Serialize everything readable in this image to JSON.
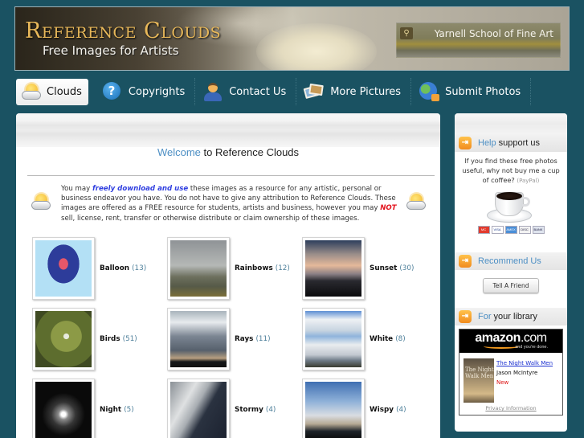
{
  "header": {
    "site_title": "Reference Clouds",
    "tagline": "Free Images for Artists",
    "sponsor": "Yarnell School of Fine Art",
    "sponsor_icon": "magnifier-icon"
  },
  "nav": {
    "items": [
      {
        "label": "Clouds",
        "icon": "sun-cloud-icon",
        "active": true
      },
      {
        "label": "Copyrights",
        "icon": "question-icon",
        "active": false
      },
      {
        "label": "Contact Us",
        "icon": "person-icon",
        "active": false
      },
      {
        "label": "More Pictures",
        "icon": "photos-icon",
        "active": false
      },
      {
        "label": "Submit Photos",
        "icon": "globe-upload-icon",
        "active": false
      }
    ]
  },
  "main": {
    "welcome_highlight": "Welcome",
    "welcome_rest": " to Reference Clouds",
    "intro": {
      "p1": "You may ",
      "free": "freely download and use",
      "p2": " these images as a resource for any artistic, personal or business endeavor you have. You do not have to give any attribution to Reference Clouds. These images are offered as a FREE resource for students, artists and business, however you may ",
      "not": "NOT",
      "p3": " sell, license, rent, transfer or otherwise distribute or claim ownership of these images."
    },
    "categories": [
      {
        "name": "Balloon",
        "count": "(13)"
      },
      {
        "name": "Rainbows",
        "count": "(12)"
      },
      {
        "name": "Sunset",
        "count": "(30)"
      },
      {
        "name": "Birds",
        "count": "(51)"
      },
      {
        "name": "Rays",
        "count": "(11)"
      },
      {
        "name": "White",
        "count": "(8)"
      },
      {
        "name": "Night",
        "count": "(5)"
      },
      {
        "name": "Stormy",
        "count": "(4)"
      },
      {
        "name": "Wispy",
        "count": "(4)"
      }
    ]
  },
  "sidebar": {
    "support": {
      "title_hl": "Help",
      "title_rest": "support us",
      "text": "If you find these free photos useful, why not buy me a cup of coffee?",
      "paypal": "(PayPal)",
      "cards": [
        "MC",
        "VISA",
        "AMEX",
        "DISC",
        "BANK"
      ]
    },
    "recommend": {
      "title_hl": "Recommend",
      "title_rest": "Us",
      "button": "Tell A Friend"
    },
    "library": {
      "title_hl": "For",
      "title_rest": "your library",
      "amazon_logo": "amazon",
      "amazon_dotcom": ".com",
      "amazon_tagline": "and you're done.",
      "book_cover_text": "The Night Walk Men",
      "book_title": "The Night Walk Men",
      "book_author": "Jason McIntyre",
      "book_status": "New",
      "privacy": "Privacy Information"
    }
  },
  "colors": {
    "background": "#1a5262",
    "accent_blue": "#4d8fc4",
    "logo_gold": "#e8b85a",
    "free_blue": "#2f3ee0",
    "not_red": "#e3121c"
  }
}
